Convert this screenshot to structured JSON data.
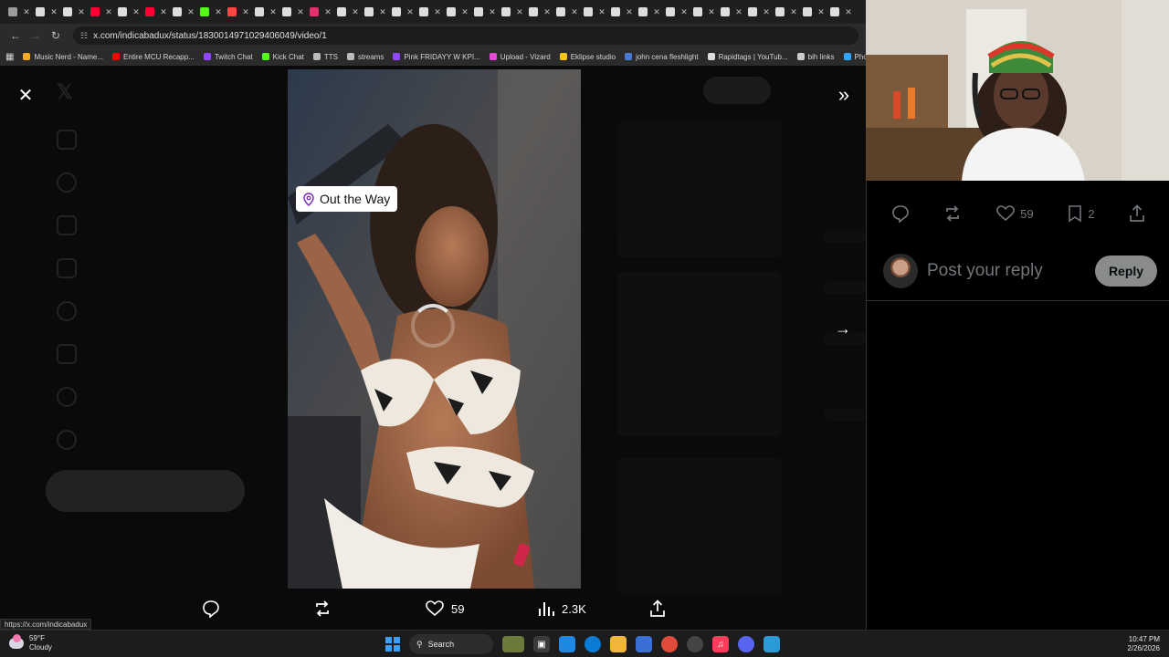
{
  "browser": {
    "url": "x.com/indicabadux/status/1830014971029406049/video/1",
    "bookmarks": [
      {
        "label": "Music Nerd - Name...",
        "color": "#f5a623"
      },
      {
        "label": "Entire MCU Recapp...",
        "color": "#ff0000"
      },
      {
        "label": "Twitch Chat",
        "color": "#9146ff"
      },
      {
        "label": "Kick Chat",
        "color": "#53fc18"
      },
      {
        "label": "TTS",
        "color": "#bbbbbb"
      },
      {
        "label": "streams",
        "color": "#bbbbbb"
      },
      {
        "label": "Pink FRIDAYY W KPI...",
        "color": "#9146ff"
      },
      {
        "label": "Upload - Vizard",
        "color": "#e24bd7"
      },
      {
        "label": "Eklipse studio",
        "color": "#f5c518"
      },
      {
        "label": "john cena fleshlight",
        "color": "#4a7bd1"
      },
      {
        "label": "Rapidtags | YouTub...",
        "color": "#dddddd"
      },
      {
        "label": "bih links",
        "color": "#cccccc"
      },
      {
        "label": "Photop",
        "color": "#31a8ff"
      }
    ],
    "tab_count_colors": [
      "#9a9a9a",
      "#dddddd",
      "#dddddd",
      "#ff0033",
      "#dddddd",
      "#ff0033",
      "#dddddd",
      "#53fc18",
      "#ff4444",
      "#dddddd",
      "#dddddd",
      "#e1306c",
      "#dddddd",
      "#dddddd",
      "#dddddd",
      "#dddddd",
      "#dddddd",
      "#dddddd",
      "#dddddd",
      "#dddddd",
      "#dddddd",
      "#dddddd",
      "#dddddd",
      "#dddddd",
      "#dddddd",
      "#dddddd",
      "#dddddd",
      "#dddddd",
      "#dddddd",
      "#dddddd",
      "#dddddd"
    ]
  },
  "viewer": {
    "location_label": "Out the Way",
    "comment_count": "",
    "like_count": "59",
    "view_count": "2.3K"
  },
  "panel": {
    "like_count": "59",
    "bookmark_count": "2",
    "reply_placeholder": "Post your reply",
    "reply_button": "Reply"
  },
  "status_link": "https://x.com/indicabadux",
  "taskbar": {
    "weather_temp": "59°F",
    "weather_desc": "Cloudy",
    "search_label": "Search",
    "time": "10:47 PM",
    "date": "2/26/2026"
  }
}
